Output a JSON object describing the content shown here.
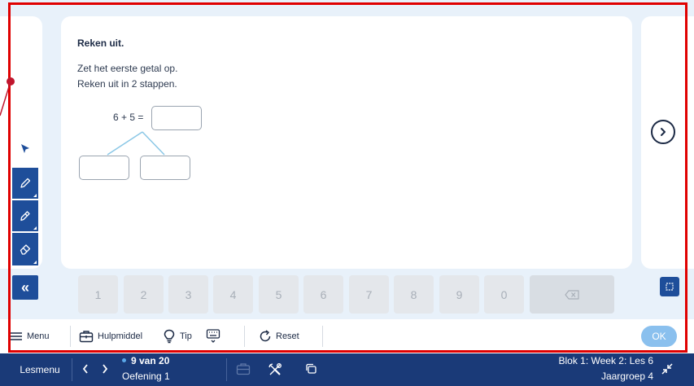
{
  "exercise": {
    "title": "Reken uit.",
    "instruction_1": "Zet het eerste getal op.",
    "instruction_2": "Reken uit in 2 stappen.",
    "equation": "6 + 5 ="
  },
  "tools": {
    "pointer_icon": "cursor-arrow-icon",
    "pencil_icon": "pencil-icon",
    "marker_icon": "highlighter-icon",
    "eraser_icon": "eraser-icon",
    "collapse_label": "«"
  },
  "keypad": {
    "keys": [
      "1",
      "2",
      "3",
      "4",
      "5",
      "6",
      "7",
      "8",
      "9",
      "0"
    ],
    "backspace_icon": "backspace-icon"
  },
  "toolbar": {
    "menu_label": "Menu",
    "hulpmiddel_label": "Hulpmiddel",
    "tip_label": "Tip",
    "reset_label": "Reset",
    "ok_label": "OK"
  },
  "bottom_bar": {
    "lesmenu_label": "Lesmenu",
    "progress": "9 van 20",
    "exercise_name": "Oefening 1",
    "lesson": "Blok 1: Week 2: Les 6",
    "group": "Jaargroep 4"
  },
  "colors": {
    "brand_blue": "#1a3a78",
    "tool_blue": "#1e4e9a",
    "panel_bg": "#e8f1fa",
    "annotation_red": "#e00000",
    "ok_button": "#8ac0ee",
    "split_line": "#8ac7e6"
  }
}
